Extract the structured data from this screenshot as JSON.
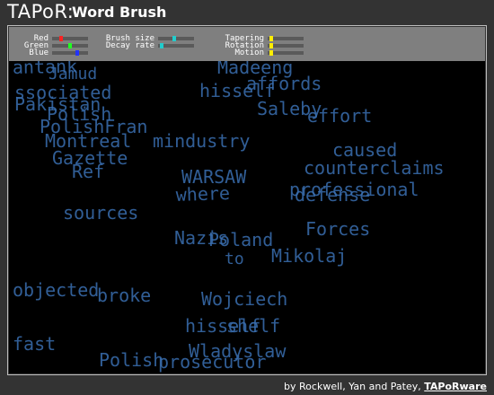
{
  "header": {
    "logo": "TAPoR:",
    "title": "Word Brush"
  },
  "controls": {
    "red": {
      "label": "Red",
      "level": 0.22,
      "color": "#ff2222"
    },
    "green": {
      "label": "Green",
      "level": 0.5,
      "color": "#22ff22"
    },
    "blue": {
      "label": "Blue",
      "level": 0.72,
      "color": "#2233ff"
    },
    "brush_size": {
      "label": "Brush size",
      "level": 0.45,
      "color": "#22cccc"
    },
    "decay_rate": {
      "label": "Decay rate",
      "level": 0.05,
      "color": "#22cccc"
    },
    "tapering": {
      "label": "Tapering",
      "level": 0.05,
      "color": "#ffee00"
    },
    "rotation": {
      "label": "Rotation",
      "level": 0.05,
      "color": "#ffee00"
    },
    "motion": {
      "label": "Motion",
      "level": 0.05,
      "color": "#ffee00"
    }
  },
  "canvas": {
    "brush_color": "#3a6fb0",
    "words": [
      "antank",
      "Jamud",
      "ssociated",
      "Pakistan",
      "Polish",
      "PolishFran",
      "Montreal",
      "Gazette",
      "Madeeng",
      "hisself",
      "affords",
      "Saleby",
      "Ref",
      "mindustry",
      "effort",
      "WARSAW",
      "where",
      "caused",
      "counterclaims",
      "professional",
      "defense",
      "sources",
      "Nazis",
      "Poland",
      "to",
      "Mikolaj",
      "Forces",
      "objected",
      "broke",
      "Wojciech",
      "hisself",
      "shelf",
      "Polish",
      "Wladyslaw",
      "fast",
      "prosecutor"
    ]
  },
  "footer": {
    "credit": "by Rockwell, Yan and Patey,",
    "link": "TAPoRware"
  }
}
